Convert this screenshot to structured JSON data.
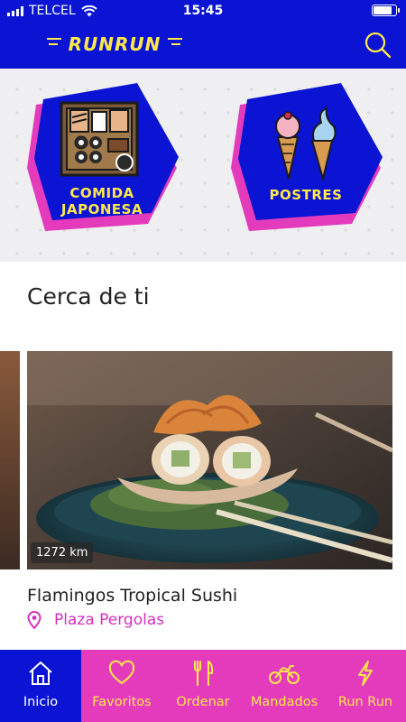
{
  "status_bar": {
    "carrier": "TELCEL",
    "time": "15:45",
    "battery_level": 0.85
  },
  "header": {
    "logo_text": "RUNRUN",
    "search_icon": "search-icon"
  },
  "categories": [
    {
      "line1": "COMIDA",
      "line2": "JAPONESA",
      "icon": "sushi-icon"
    },
    {
      "line1": "POSTRES",
      "line2": "",
      "icon": "ice-cream-icon"
    }
  ],
  "section": {
    "title": "Cerca de ti"
  },
  "restaurant": {
    "distance": "1272 km",
    "name": "Flamingos Tropical Sushi",
    "location": "Plaza Pergolas",
    "location_icon": "map-pin-icon"
  },
  "nav": {
    "items": [
      {
        "label": "Inicio",
        "icon": "home-icon",
        "active": true
      },
      {
        "label": "Favoritos",
        "icon": "heart-icon",
        "active": false
      },
      {
        "label": "Ordenar",
        "icon": "utensils-icon",
        "active": false
      },
      {
        "label": "Mandados",
        "icon": "motorcycle-icon",
        "active": false
      },
      {
        "label": "Run Run",
        "icon": "lightning-icon",
        "active": false
      }
    ]
  },
  "colors": {
    "brand_blue": "#0a14d2",
    "brand_pink": "#e43bbd",
    "brand_yellow": "#ffe94a"
  }
}
